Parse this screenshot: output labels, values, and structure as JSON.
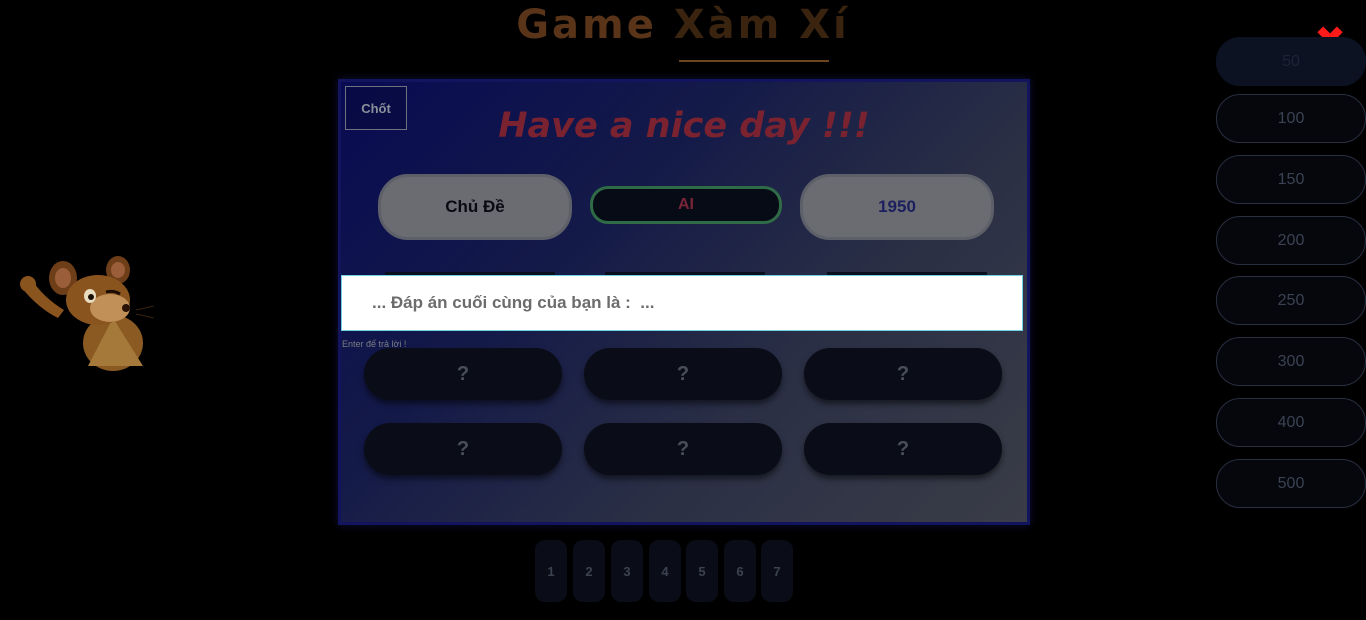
{
  "title": {
    "part1": "Game ",
    "part2": "Xàm Xí"
  },
  "close_icon": "close-x-icon",
  "scores": [
    "50",
    "100",
    "150",
    "200",
    "250",
    "300",
    "400",
    "500"
  ],
  "board": {
    "confirm_label": "Chốt",
    "greeting": "Have a nice day !!!",
    "topic_label": "Chủ Đề",
    "category_label": "AI",
    "year_label": "1950",
    "answer_placeholder": "... Đáp án cuối cùng của bạn là :  ...",
    "hint": "Enter để trả lời !",
    "cards": [
      "?",
      "?",
      "?",
      "?",
      "?",
      "?"
    ]
  },
  "numbers": [
    "1",
    "2",
    "3",
    "4",
    "5",
    "6",
    "7"
  ],
  "colors": {
    "close": "#ff1a1a",
    "greeting": "#7a2230",
    "ai_border": "#2f6b47"
  },
  "mascot_icon": "mouse-mascot-icon"
}
